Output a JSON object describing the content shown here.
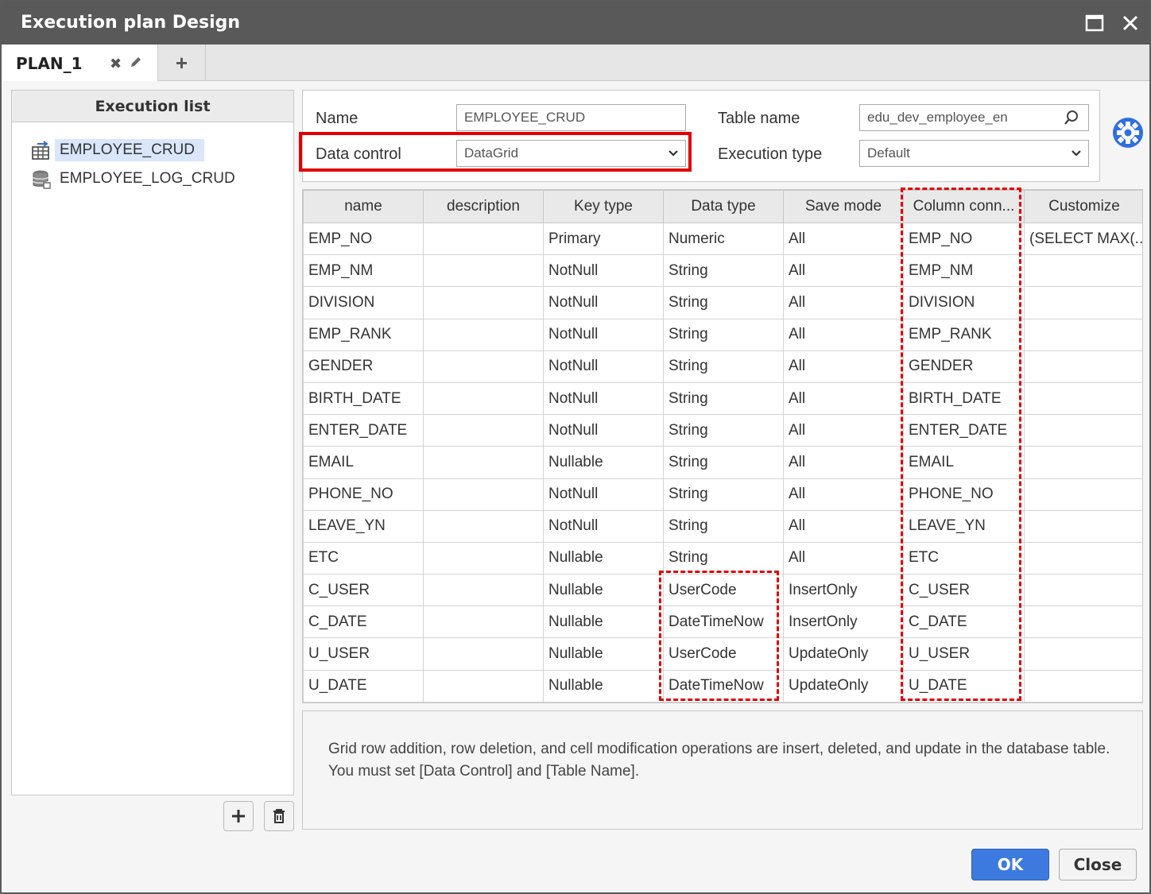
{
  "window": {
    "title": "Execution plan Design",
    "maximize_icon": "maximize-icon",
    "close_icon": "close-icon"
  },
  "tabs": {
    "items": [
      {
        "label": "PLAN_1",
        "close_icon": "close-icon",
        "edit_icon": "pencil-icon"
      }
    ],
    "add_label": "+"
  },
  "execution_list": {
    "title": "Execution list",
    "items": [
      {
        "label": "EMPLOYEE_CRUD",
        "icon": "table-arrow-icon",
        "selected": true
      },
      {
        "label": "EMPLOYEE_LOG_CRUD",
        "icon": "database-icon",
        "selected": false
      }
    ],
    "add_icon": "plus-icon",
    "delete_icon": "trash-icon"
  },
  "form": {
    "name_label": "Name",
    "name_value": "EMPLOYEE_CRUD",
    "data_control_label": "Data control",
    "data_control_value": "DataGrid",
    "table_name_label": "Table name",
    "table_name_value": "edu_dev_employee_en",
    "execution_type_label": "Execution type",
    "execution_type_value": "Default",
    "settings_icon": "gear-icon"
  },
  "grid": {
    "columns": [
      "name",
      "description",
      "Key type",
      "Data type",
      "Save mode",
      "Column conn...",
      "Customize"
    ],
    "rows": [
      [
        "EMP_NO",
        "",
        "Primary",
        "Numeric",
        "All",
        "EMP_NO",
        "(SELECT MAX(..."
      ],
      [
        "EMP_NM",
        "",
        "NotNull",
        "String",
        "All",
        "EMP_NM",
        ""
      ],
      [
        "DIVISION",
        "",
        "NotNull",
        "String",
        "All",
        "DIVISION",
        ""
      ],
      [
        "EMP_RANK",
        "",
        "NotNull",
        "String",
        "All",
        "EMP_RANK",
        ""
      ],
      [
        "GENDER",
        "",
        "NotNull",
        "String",
        "All",
        "GENDER",
        ""
      ],
      [
        "BIRTH_DATE",
        "",
        "NotNull",
        "String",
        "All",
        "BIRTH_DATE",
        ""
      ],
      [
        "ENTER_DATE",
        "",
        "NotNull",
        "String",
        "All",
        "ENTER_DATE",
        ""
      ],
      [
        "EMAIL",
        "",
        "Nullable",
        "String",
        "All",
        "EMAIL",
        ""
      ],
      [
        "PHONE_NO",
        "",
        "NotNull",
        "String",
        "All",
        "PHONE_NO",
        ""
      ],
      [
        "LEAVE_YN",
        "",
        "NotNull",
        "String",
        "All",
        "LEAVE_YN",
        ""
      ],
      [
        "ETC",
        "",
        "Nullable",
        "String",
        "All",
        "ETC",
        ""
      ],
      [
        "C_USER",
        "",
        "Nullable",
        "UserCode",
        "InsertOnly",
        "C_USER",
        ""
      ],
      [
        "C_DATE",
        "",
        "Nullable",
        "DateTimeNow",
        "InsertOnly",
        "C_DATE",
        ""
      ],
      [
        "U_USER",
        "",
        "Nullable",
        "UserCode",
        "UpdateOnly",
        "U_USER",
        ""
      ],
      [
        "U_DATE",
        "",
        "Nullable",
        "DateTimeNow",
        "UpdateOnly",
        "U_DATE",
        ""
      ]
    ]
  },
  "description": {
    "line1": "Grid row addition, row deletion, and cell modification operations are insert, deleted, and update in the database table.",
    "line2": "You must set [Data Control] and [Table Name]."
  },
  "buttons": {
    "ok": "OK",
    "close": "Close"
  },
  "colors": {
    "highlight": "#e00000",
    "primary": "#3d7ae0",
    "titlebar": "#595959"
  }
}
